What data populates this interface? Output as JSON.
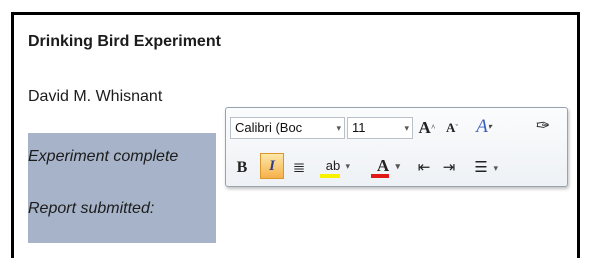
{
  "document": {
    "title": "Drinking Bird Experiment",
    "author": "David M. Whisnant",
    "selected_lines": [
      "Experiment complete",
      "Report submitted:"
    ]
  },
  "mini_toolbar": {
    "font_name": "Calibri (Boc",
    "font_size": "11",
    "grow_font_label": "A",
    "shrink_font_label": "A",
    "styles_label": "A",
    "format_painter_icon": "✑",
    "bold_label": "B",
    "italic_label": "I",
    "center_icon": "≣",
    "highlight_label": "ab",
    "font_color_label": "A",
    "outdent_icon": "⇤",
    "indent_icon": "⇥",
    "bullets_icon": "☰",
    "dropdown_arrow": "▾"
  },
  "colors": {
    "selection": "#a7b3c9",
    "highlight": "#f6f200",
    "font_color": "#e01818",
    "italic_active": "#f6b14b"
  }
}
